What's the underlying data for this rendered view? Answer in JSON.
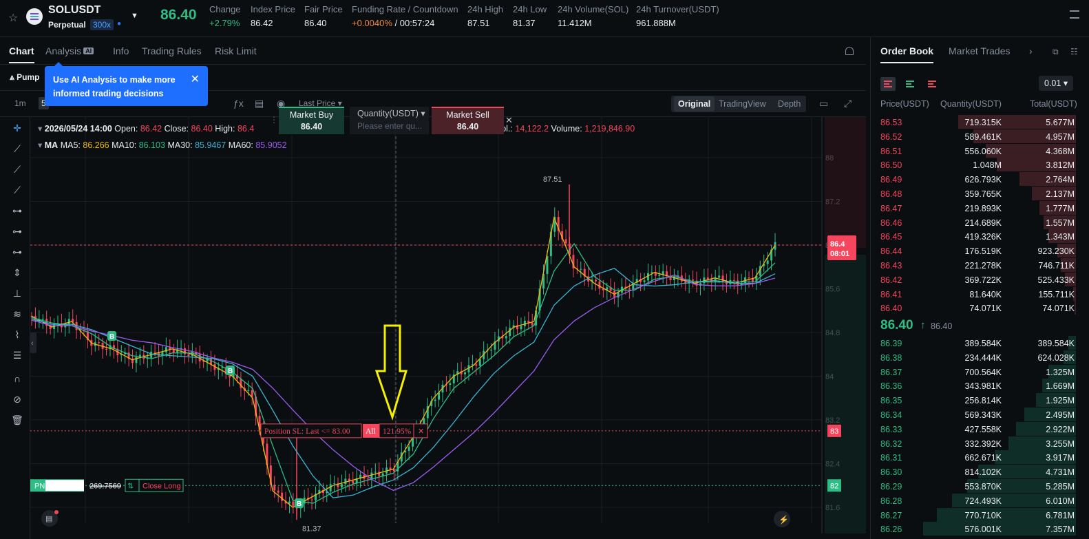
{
  "header": {
    "symbol": "SOLUSDT",
    "contract_type": "Perpetual",
    "leverage": "300x",
    "last_price": "86.40",
    "stats": [
      {
        "label": "Change",
        "value": "+2.79%",
        "tone": "green"
      },
      {
        "label": "Index Price",
        "value": "86.42",
        "tone": ""
      },
      {
        "label": "Fair Price",
        "value": "86.40",
        "tone": ""
      },
      {
        "label": "Funding Rate / Countdown",
        "value_a": "+0.0040%",
        "value_b": "/ 00:57:24"
      },
      {
        "label": "24h High",
        "value": "87.51",
        "tone": ""
      },
      {
        "label": "24h Low",
        "value": "81.37",
        "tone": ""
      },
      {
        "label": "24h Volume(SOL)",
        "value": "11.412M",
        "tone": ""
      },
      {
        "label": "24h Turnover(USDT)",
        "value": "961.888M",
        "tone": ""
      }
    ]
  },
  "left_tabs": {
    "chart": "Chart",
    "analysis": "Analysis",
    "analysis_badge": "AI",
    "info": "Info",
    "trading_rules": "Trading Rules",
    "risk_limit": "Risk Limit"
  },
  "subbar": {
    "pump_label": "Pump"
  },
  "tooltip": {
    "text": "Use AI Analysis to make more informed trading decisions"
  },
  "toolbar": {
    "tf_1m": "1m",
    "tf_5": "5",
    "last_price_select": "Last Price",
    "views": [
      "Original",
      "TradingView",
      "Depth"
    ]
  },
  "quick_trade": {
    "buy_label": "Market Buy",
    "buy_price": "86.40",
    "qty_label": "Quantity(USDT)",
    "qty_placeholder": "Please enter qu...",
    "sell_label": "Market Sell",
    "sell_price": "86.40"
  },
  "legend": {
    "date": "2026/05/24 14:00",
    "open_label": "Open:",
    "open": "86.42",
    "close_label": "Close:",
    "close": "86.40",
    "high_label": "High:",
    "high": "86.4",
    "fill_vol_label": "ill Vol.:",
    "fill_vol": "14,122.2",
    "volume_label": "Volume:",
    "volume": "1,219,846.90",
    "ma_label": "MA",
    "ma5_label": "MA5:",
    "ma5": "86.266",
    "ma10_label": "MA10:",
    "ma10": "86.103",
    "ma30_label": "MA30:",
    "ma30": "85.9467",
    "ma60_label": "MA60:",
    "ma60": "85.9052"
  },
  "chart_overlay": {
    "high_marker": "87.51",
    "low_marker": "81.37",
    "sl_order": "Position SL: Last <= 83.00",
    "sl_all": "All",
    "sl_pct": "121.95%",
    "sl_axis_tag": "83",
    "pnl_label": "PN",
    "pnl_value": "269.7569",
    "close_long": "Close Long",
    "entry_axis_tag": "82",
    "current_tag_price": "86.4",
    "current_tag_time": "08:01",
    "buy_marker": "B"
  },
  "chart_data": {
    "type": "line",
    "y_ticks": [
      "88",
      "87.2",
      "86.4",
      "85.6",
      "84.8",
      "84",
      "83.2",
      "82.4",
      "81.6"
    ],
    "ylim": [
      81.4,
      88.4
    ],
    "series": [
      {
        "name": "MA5",
        "color": "#f0b90b"
      },
      {
        "name": "MA10",
        "color": "#2ebd85"
      },
      {
        "name": "MA30",
        "color": "#38b6d4"
      },
      {
        "name": "MA60",
        "color": "#9d5cf0"
      }
    ],
    "approx_close_path": [
      85.1,
      84.9,
      85.0,
      84.6,
      84.5,
      84.3,
      84.4,
      84.5,
      84.4,
      84.2,
      84.0,
      83.6,
      81.9,
      81.6,
      81.8,
      82.0,
      82.1,
      82.2,
      82.3,
      82.9,
      83.6,
      84.0,
      84.2,
      84.6,
      84.9,
      85.0,
      86.9,
      86.0,
      85.7,
      85.5,
      85.7,
      85.9,
      85.8,
      85.7,
      85.8,
      85.7,
      85.8,
      86.4
    ]
  },
  "right_panel": {
    "tab_order_book": "Order Book",
    "tab_market_trades": "Market Trades",
    "precision": "0.01",
    "col_price": "Price(USDT)",
    "col_qty": "Quantity(USDT)",
    "col_total": "Total(USDT)",
    "asks": [
      {
        "p": "86.53",
        "q": "719.315K",
        "t": "5.677M",
        "depth": 0.77
      },
      {
        "p": "86.52",
        "q": "589.461K",
        "t": "4.957M",
        "depth": 0.67
      },
      {
        "p": "86.51",
        "q": "556.060K",
        "t": "4.368M",
        "depth": 0.59
      },
      {
        "p": "86.50",
        "q": "1.048M",
        "t": "3.812M",
        "depth": 0.52
      },
      {
        "p": "86.49",
        "q": "626.793K",
        "t": "2.764M",
        "depth": 0.37
      },
      {
        "p": "86.48",
        "q": "359.765K",
        "t": "2.137M",
        "depth": 0.29
      },
      {
        "p": "86.47",
        "q": "219.893K",
        "t": "1.777M",
        "depth": 0.24
      },
      {
        "p": "86.46",
        "q": "214.689K",
        "t": "1.557M",
        "depth": 0.21
      },
      {
        "p": "86.45",
        "q": "419.326K",
        "t": "1.343M",
        "depth": 0.18
      },
      {
        "p": "86.44",
        "q": "176.519K",
        "t": "923.230K",
        "depth": 0.12
      },
      {
        "p": "86.43",
        "q": "221.278K",
        "t": "746.711K",
        "depth": 0.1
      },
      {
        "p": "86.42",
        "q": "369.722K",
        "t": "525.433K",
        "depth": 0.07
      },
      {
        "p": "86.41",
        "q": "81.640K",
        "t": "155.711K",
        "depth": 0.02
      },
      {
        "p": "86.40",
        "q": "74.071K",
        "t": "74.071K",
        "depth": 0.01
      }
    ],
    "mid_price": "86.40",
    "mid_mark": "86.40",
    "bids": [
      {
        "p": "86.39",
        "q": "389.584K",
        "t": "389.584K",
        "depth": 0.05
      },
      {
        "p": "86.38",
        "q": "234.444K",
        "t": "624.028K",
        "depth": 0.08
      },
      {
        "p": "86.37",
        "q": "700.564K",
        "t": "1.325M",
        "depth": 0.18
      },
      {
        "p": "86.36",
        "q": "343.981K",
        "t": "1.669M",
        "depth": 0.22
      },
      {
        "p": "86.35",
        "q": "256.814K",
        "t": "1.925M",
        "depth": 0.26
      },
      {
        "p": "86.34",
        "q": "569.343K",
        "t": "2.495M",
        "depth": 0.34
      },
      {
        "p": "86.33",
        "q": "427.558K",
        "t": "2.922M",
        "depth": 0.39
      },
      {
        "p": "86.32",
        "q": "332.392K",
        "t": "3.255M",
        "depth": 0.44
      },
      {
        "p": "86.31",
        "q": "662.671K",
        "t": "3.917M",
        "depth": 0.53
      },
      {
        "p": "86.30",
        "q": "814.102K",
        "t": "4.731M",
        "depth": 0.64
      },
      {
        "p": "86.29",
        "q": "553.870K",
        "t": "5.285M",
        "depth": 0.71
      },
      {
        "p": "86.28",
        "q": "724.493K",
        "t": "6.010M",
        "depth": 0.81
      },
      {
        "p": "86.27",
        "q": "770.710K",
        "t": "6.781M",
        "depth": 0.91
      },
      {
        "p": "86.26",
        "q": "576.001K",
        "t": "7.357M",
        "depth": 1.0
      }
    ]
  }
}
